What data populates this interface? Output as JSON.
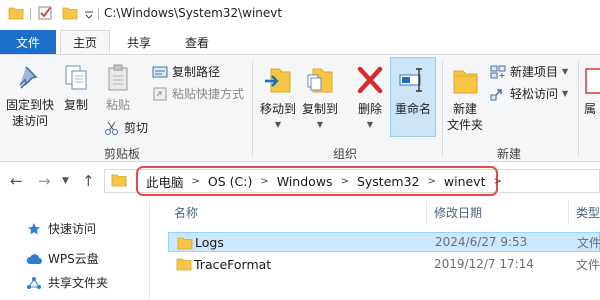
{
  "window": {
    "title": "C:\\Windows\\System32\\winevt"
  },
  "tabs": [
    {
      "label": "文件"
    },
    {
      "label": "主页"
    },
    {
      "label": "共享"
    },
    {
      "label": "查看"
    }
  ],
  "ribbon": {
    "clipboard": {
      "pin_label_1": "固定到快",
      "pin_label_2": "速访问",
      "copy_label": "复制",
      "paste_label": "粘贴",
      "copy_path_label": "复制路径",
      "paste_shortcut_label": "粘贴快捷方式",
      "cut_label": "剪切",
      "group_label": "剪贴板"
    },
    "organize": {
      "move_to_label": "移动到",
      "copy_to_label": "复制到",
      "delete_label": "删除",
      "rename_label": "重命名",
      "group_label": "组织"
    },
    "new": {
      "new_folder_label_1": "新建",
      "new_folder_label_2": "文件夹",
      "new_item_label": "新建项目",
      "easy_access_label": "轻松访问",
      "group_label": "新建"
    },
    "open": {
      "properties_partial": "属"
    }
  },
  "address": {
    "crumbs": [
      "此电脑",
      "OS (C:)",
      "Windows",
      "System32",
      "winevt"
    ]
  },
  "nav_pane": {
    "items": [
      {
        "label": "快速访问"
      },
      {
        "label": "WPS云盘"
      },
      {
        "label": "共享文件夹"
      }
    ]
  },
  "columns": {
    "name": "名称",
    "date": "修改日期",
    "type": "类型"
  },
  "files": [
    {
      "name": "Logs",
      "date": "2024/6/27 9:53",
      "type": "文件"
    },
    {
      "name": "TraceFormat",
      "date": "2019/12/7 17:14",
      "type": "文件"
    }
  ],
  "colors": {
    "accent": "#1c6fc8",
    "highlight": "#e54b4b",
    "selection": "#cce8ff",
    "folder": "#f8c647"
  }
}
